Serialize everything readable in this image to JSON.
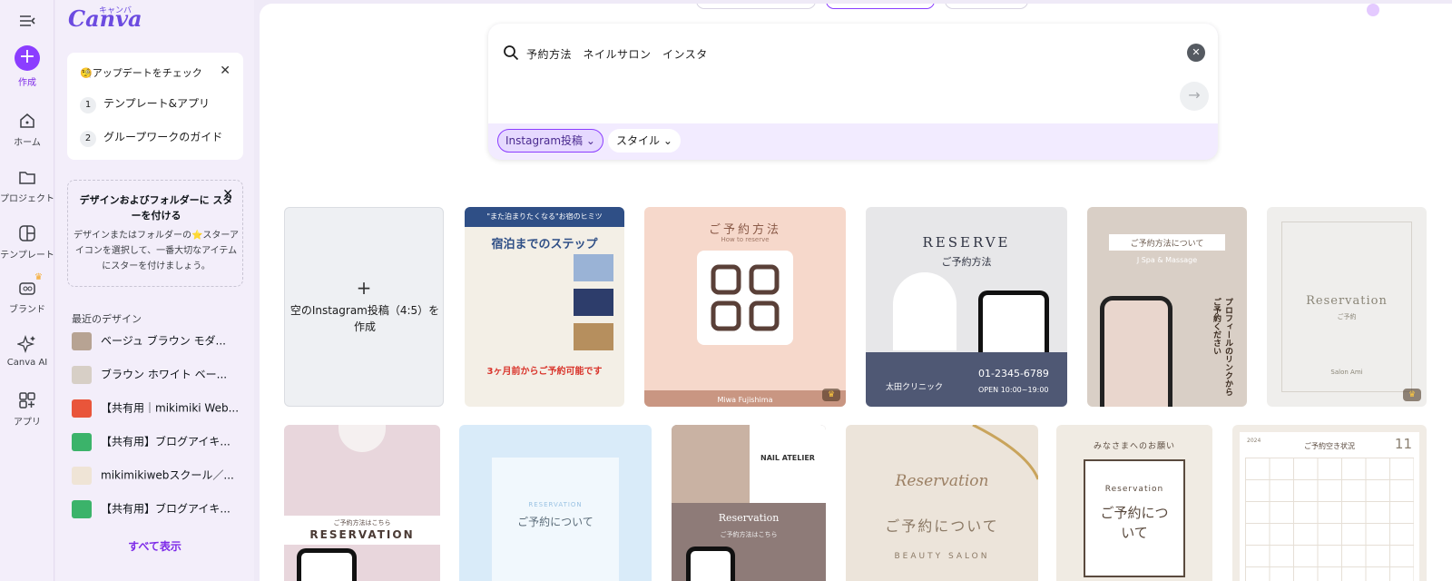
{
  "rail": {
    "create": "作成",
    "home": "ホーム",
    "projects": "プロジェクト",
    "templates": "テンプレート",
    "brand": "ブランド",
    "canva_ai": "Canva AI",
    "apps": "アプリ"
  },
  "panel": {
    "logo": "Canva",
    "logo_kana": "キャンバ",
    "update_card": {
      "title": "🧐アップデートをチェック",
      "steps": [
        {
          "num": "1",
          "label": "テンプレート&アプリ"
        },
        {
          "num": "2",
          "label": "グループワークのガイド"
        }
      ]
    },
    "star_card": {
      "title": "デザインおよびフォルダーに スターを付ける",
      "body": "デザインまたはフォルダーの⭐スターアイコンを選択して、一番大切なアイテムにスターを付けましょう。"
    },
    "recent_heading": "最近のデザイン",
    "recent": [
      "ベージュ ブラウン モダ...",
      "ブラウン ホワイト ベー...",
      "【共有用｜mikimiki Web...",
      "【共有用】ブログアイキ...",
      "mikimikiwebスクール／...",
      "【共有用】ブログアイキ..."
    ],
    "show_all": "すべて表示"
  },
  "search": {
    "query": "予約方法　ネイルサロン　インスタ",
    "chips": [
      "Instagram投稿",
      "スタイル"
    ]
  },
  "results": {
    "blank_tile": "空のInstagram投稿（4:5）を作成",
    "row1": [
      {
        "top": "\"また泊まりたくなる\"お宿のヒミツ",
        "title": "宿泊までのステップ",
        "footer": "3ヶ月前からご予約可能です"
      },
      {
        "title": "ご予約方法",
        "sub": "How to reserve",
        "footer": "Miwa Fujishima"
      },
      {
        "title": "RESERVE",
        "sub": "ご予約方法",
        "phone": "01-2345-6789",
        "hours": "OPEN 10:00~19:00",
        "clinic": "太田クリニック"
      },
      {
        "title": "ご予約方法について",
        "sub": "J Spa & Massage",
        "side": "プロフィールのリンクからご予約ください"
      },
      {
        "title": "Reservation",
        "sub": "ご予約",
        "footer": "Salon Ami"
      }
    ],
    "row2": [
      {
        "label": "ご予約方法はこちら",
        "title": "RESERVATION"
      },
      {
        "sub": "RESERVATION",
        "title": "ご予約について"
      },
      {
        "title": "NAIL ATELIER",
        "sub": "Reservation",
        "note": "ご予約方法はこちら"
      },
      {
        "title": "Reservation",
        "sub": "ご予約について",
        "footer": "BEAUTY SALON"
      },
      {
        "top": "みなさまへのお願い",
        "sub": "Reservation",
        "title": "ご予約について"
      },
      {
        "title": "ご予約空き状況",
        "month": "11",
        "year": "2024"
      }
    ]
  }
}
